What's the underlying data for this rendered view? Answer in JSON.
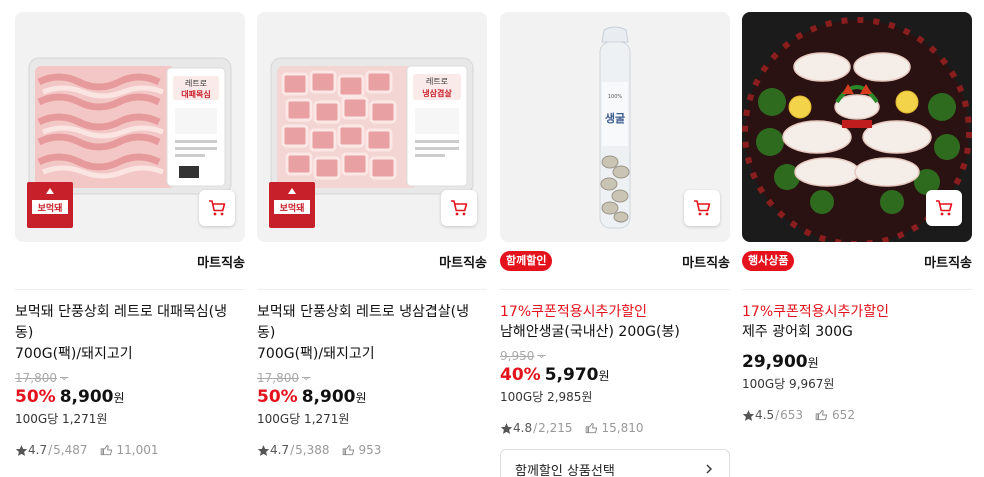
{
  "products": [
    {
      "image_desc": "pork-belly-tray",
      "brand_logo_text": "보먹돼",
      "label_text": "레트로 대패목심",
      "badge": "",
      "delivery": "마트직송",
      "promo": "",
      "title_line1": "보먹돼 단풍상회 레트로 대패목심(냉동)",
      "title_line2": "700G(팩)/돼지고기",
      "original_price": "17,800",
      "discount": "50%",
      "price": "8,900",
      "won": "원",
      "unit_price": "100G당 1,271원",
      "rating": "4.7",
      "review_count": "5,487",
      "likes": "11,001"
    },
    {
      "image_desc": "pork-belly-cubes-tray",
      "brand_logo_text": "보먹돼",
      "label_text": "레트로 냉삼겹살",
      "badge": "",
      "delivery": "마트직송",
      "promo": "",
      "title_line1": "보먹돼 단풍상회 레트로 냉삼겹살(냉동)",
      "title_line2": "700G(팩)/돼지고기",
      "original_price": "17,800",
      "discount": "50%",
      "price": "8,900",
      "won": "원",
      "unit_price": "100G당 1,271원",
      "rating": "4.7",
      "review_count": "5,388",
      "likes": "953"
    },
    {
      "image_desc": "oyster-bag",
      "label_text": "생굴",
      "badge": "함께할인",
      "delivery": "마트직송",
      "promo": "17%쿠폰적용시추가할인",
      "title_line1": "남해안생굴(국내산) 200G(봉)",
      "title_line2": "",
      "original_price": "9,950",
      "discount": "40%",
      "price": "5,970",
      "won": "원",
      "unit_price": "100G당 2,985원",
      "rating": "4.8",
      "review_count": "2,215",
      "likes": "15,810",
      "bundle_button": "함께할인 상품선택"
    },
    {
      "image_desc": "flounder-sashimi-platter",
      "badge": "행사상품",
      "delivery": "마트직송",
      "promo": "17%쿠폰적용시추가할인",
      "title_line1": "제주 광어회 300G",
      "title_line2": "",
      "original_price": "",
      "discount": "",
      "price": "29,900",
      "won": "원",
      "unit_price": "100G당 9,967원",
      "rating": "4.5",
      "review_count": "653",
      "likes": "652"
    }
  ],
  "icons": {
    "cart": "cart-icon",
    "star": "star-icon",
    "like": "like-hand-icon",
    "chevron_down": "chevron-down-icon",
    "chevron_right": "chevron-right-icon"
  },
  "colors": {
    "accent_red": "#e3121c",
    "brand_red": "#c8202b"
  }
}
